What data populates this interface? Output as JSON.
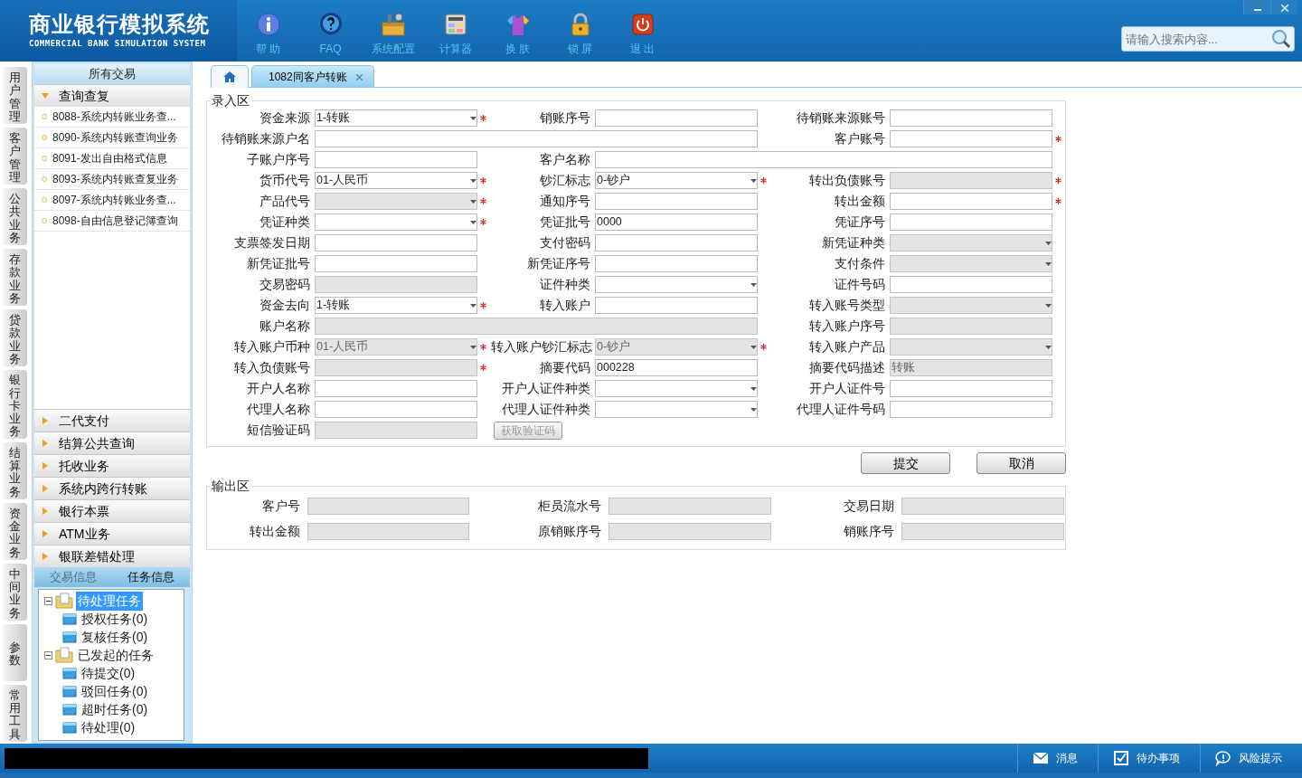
{
  "header": {
    "title": "商业银行模拟系统",
    "subtitle": "COMMERCIAL BANK SIMULATION SYSTEM",
    "toolbar": [
      {
        "label": "帮 助"
      },
      {
        "label": "FAQ"
      },
      {
        "label": "系统配置"
      },
      {
        "label": "计算器"
      },
      {
        "label": "换 肤"
      },
      {
        "label": "锁 屏"
      },
      {
        "label": "退 出"
      }
    ],
    "search": {
      "placeholder": "请输入搜索内容..."
    }
  },
  "side_tabs": [
    {
      "label": "用户管理"
    },
    {
      "label": "客户管理"
    },
    {
      "label": "公共业务"
    },
    {
      "label": "存款业务"
    },
    {
      "label": "贷款业务"
    },
    {
      "label": "银行卡业务"
    },
    {
      "label": "结算业务"
    },
    {
      "label": "资金业务"
    },
    {
      "label": "中间业务"
    },
    {
      "label": "参数"
    },
    {
      "label": "常用工具"
    }
  ],
  "sidebar": {
    "title": "所有交易",
    "groups": [
      {
        "label": "查询查复",
        "expanded": true,
        "items": [
          "8088-系统内转账业务查...",
          "8090-系统内转账查询业务",
          "8091-发出自由格式信息",
          "8093-系统内转账查复业务",
          "8097-系统内转账业务查...",
          "8098-自由信息登记簿查询"
        ]
      },
      {
        "label": "二代支付",
        "expanded": false
      },
      {
        "label": "结算公共查询",
        "expanded": false
      },
      {
        "label": "托收业务",
        "expanded": false
      },
      {
        "label": "系统内跨行转账",
        "expanded": false
      },
      {
        "label": "银行本票",
        "expanded": false
      },
      {
        "label": "ATM业务",
        "expanded": false
      },
      {
        "label": "银联差错处理",
        "expanded": false
      }
    ],
    "info_tabs": [
      {
        "label": "交易信息",
        "selected": false
      },
      {
        "label": "任务信息",
        "selected": true
      }
    ],
    "tree": [
      {
        "label": "待处理任务",
        "selected": true,
        "expanded": true,
        "children": [
          {
            "label": "授权任务(0)",
            "selected": false
          },
          {
            "label": "复核任务(0)",
            "selected": false
          }
        ]
      },
      {
        "label": "已发起的任务",
        "selected": false,
        "expanded": true,
        "children": [
          {
            "label": "待提交(0)",
            "selected": false
          },
          {
            "label": "驳回任务(0)",
            "selected": false
          },
          {
            "label": "超时任务(0)",
            "selected": false
          },
          {
            "label": "待处理(0)",
            "selected": false
          }
        ]
      }
    ]
  },
  "tabs": [
    {
      "kind": "home",
      "selected": false
    },
    {
      "kind": "page",
      "label": "1082同客户转账",
      "selected": true
    }
  ],
  "input_area": {
    "legend": "录入区",
    "fields": [
      {
        "label": "资金来源",
        "kind": "select",
        "value": "1-转账",
        "disabled": false,
        "required": true
      },
      {
        "label": "销账序号",
        "kind": "text",
        "disabled": false,
        "required": false
      },
      {
        "label": "待销账来源账号",
        "kind": "text",
        "disabled": false,
        "required": false
      },
      {
        "label": "待销账来源户名",
        "kind": "text",
        "disabled": false,
        "required": false,
        "wide": true
      },
      {
        "label": "客户账号",
        "kind": "text",
        "disabled": false,
        "required": true
      },
      {
        "label": "子账户序号",
        "kind": "text",
        "disabled": false,
        "required": false
      },
      {
        "label": "客户名称",
        "kind": "text",
        "disabled": false,
        "required": false,
        "wide": true
      },
      {
        "label": "货币代号",
        "kind": "select",
        "value": "01-人民币",
        "disabled": false,
        "required": true
      },
      {
        "label": "钞汇标志",
        "kind": "select",
        "value": "0-钞户",
        "disabled": false,
        "required": true
      },
      {
        "label": "转出负债账号",
        "kind": "text",
        "disabled": true,
        "required": true
      },
      {
        "label": "产品代号",
        "kind": "select",
        "disabled": true,
        "required": true
      },
      {
        "label": "通知序号",
        "kind": "text",
        "disabled": false,
        "required": false
      },
      {
        "label": "转出金额",
        "kind": "text",
        "disabled": false,
        "required": true
      },
      {
        "label": "凭证种类",
        "kind": "select",
        "disabled": false,
        "required": true
      },
      {
        "label": "凭证批号",
        "kind": "text",
        "value": "0000",
        "disabled": false,
        "required": false
      },
      {
        "label": "凭证序号",
        "kind": "text",
        "disabled": false,
        "required": false
      },
      {
        "label": "支票签发日期",
        "kind": "text",
        "disabled": false,
        "required": false
      },
      {
        "label": "支付密码",
        "kind": "text",
        "disabled": false,
        "required": false
      },
      {
        "label": "新凭证种类",
        "kind": "select",
        "disabled": true,
        "required": false
      },
      {
        "label": "新凭证批号",
        "kind": "text",
        "disabled": false,
        "required": false
      },
      {
        "label": "新凭证序号",
        "kind": "text",
        "disabled": false,
        "required": false
      },
      {
        "label": "支付条件",
        "kind": "select",
        "disabled": true,
        "required": false
      },
      {
        "label": "交易密码",
        "kind": "text",
        "disabled": true,
        "required": false
      },
      {
        "label": "证件种类",
        "kind": "select",
        "disabled": false,
        "required": false
      },
      {
        "label": "证件号码",
        "kind": "text",
        "disabled": false,
        "required": false
      },
      {
        "label": "资金去向",
        "kind": "select",
        "value": "1-转账",
        "disabled": false,
        "required": true
      },
      {
        "label": "转入账户",
        "kind": "text",
        "disabled": false,
        "required": false
      },
      {
        "label": "转入账号类型",
        "kind": "select",
        "disabled": true,
        "required": false
      },
      {
        "label": "账户名称",
        "kind": "text",
        "disabled": true,
        "required": false,
        "wide": true
      },
      {
        "label": "转入账户序号",
        "kind": "text",
        "disabled": true,
        "required": false
      },
      {
        "label": "转入账户币种",
        "kind": "select",
        "value": "01-人民币",
        "disabled": true,
        "required": true
      },
      {
        "label": "转入账户钞汇标志",
        "kind": "select",
        "value": "0-钞户",
        "disabled": true,
        "required": true
      },
      {
        "label": "转入账户产品",
        "kind": "select",
        "disabled": true,
        "required": false
      },
      {
        "label": "转入负债账号",
        "kind": "text",
        "disabled": true,
        "required": true
      },
      {
        "label": "摘要代码",
        "kind": "text",
        "value": "000228",
        "disabled": false,
        "required": false
      },
      {
        "label": "摘要代码描述",
        "kind": "text",
        "value": "转账",
        "disabled": true,
        "required": false
      },
      {
        "label": "开户人名称",
        "kind": "text",
        "disabled": false,
        "required": false
      },
      {
        "label": "开户人证件种类",
        "kind": "select",
        "disabled": false,
        "required": false
      },
      {
        "label": "开户人证件号",
        "kind": "text",
        "disabled": false,
        "required": false
      },
      {
        "label": "代理人名称",
        "kind": "text",
        "disabled": false,
        "required": false
      },
      {
        "label": "代理人证件种类",
        "kind": "select",
        "disabled": false,
        "required": false
      },
      {
        "label": "代理人证件号码",
        "kind": "text",
        "disabled": false,
        "required": false
      },
      {
        "label": "短信验证码",
        "kind": "text",
        "disabled": true,
        "required": false
      },
      {
        "label": "获取验证码",
        "kind": "button",
        "disabled": true
      }
    ]
  },
  "actions": [
    {
      "label": "提交"
    },
    {
      "label": "取消"
    }
  ],
  "output_area": {
    "legend": "输出区",
    "fields": [
      {
        "label": "客户号"
      },
      {
        "label": "柜员流水号"
      },
      {
        "label": "交易日期"
      },
      {
        "label": "转出金额"
      },
      {
        "label": "原销账序号"
      },
      {
        "label": "销账序号"
      }
    ]
  },
  "status_bar": {
    "items": [
      {
        "label": "消息"
      },
      {
        "label": "待办事项"
      },
      {
        "label": "风险提示"
      }
    ]
  }
}
